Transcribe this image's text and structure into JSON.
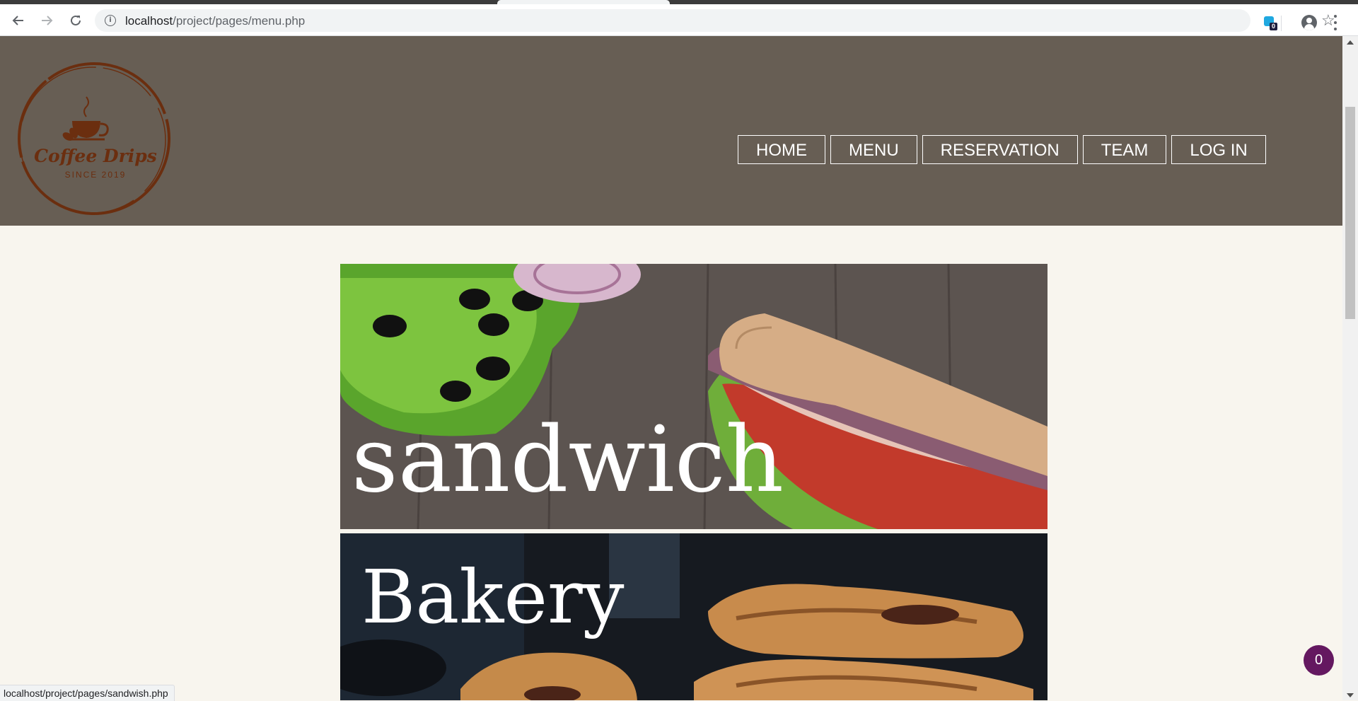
{
  "browser": {
    "url_host": "localhost",
    "url_path": "/project/pages/menu.php",
    "extension_badge": "0",
    "status_url": "localhost/project/pages/sandwish.php"
  },
  "site": {
    "logo_title": "Coffee Drips",
    "logo_subtitle": "SINCE 2019",
    "nav": [
      "HOME",
      "MENU",
      "RESERVATION",
      "TEAM",
      "LOG IN"
    ]
  },
  "tiles": {
    "sandwich": "sandwich",
    "bakery": "Bakery"
  },
  "cart": {
    "count": "0"
  },
  "colors": {
    "header_bg": "#675e54",
    "page_bg": "#f8f5ee",
    "logo_brown": "#6b2e0f",
    "cart_bubble": "#641860"
  }
}
